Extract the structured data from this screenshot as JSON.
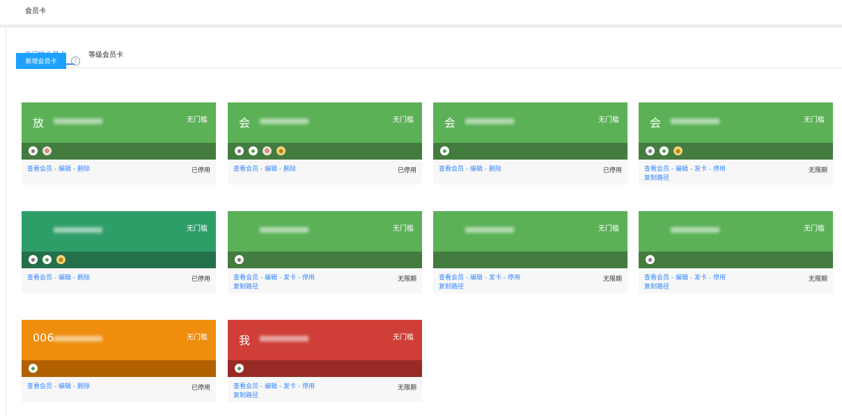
{
  "page_title": "会员卡",
  "tabs": [
    {
      "label": "无门槛会员卡",
      "active": true
    },
    {
      "label": "等级会员卡",
      "active": false
    }
  ],
  "add_button": "新增会员卡",
  "help": "?",
  "colors": {
    "accent": "#3388ff",
    "green": "#5cb157",
    "green_dark": "#437c3e",
    "teal": "#2e9e69",
    "teal_dark": "#24704b",
    "orange": "#ef8d0d",
    "orange_dark": "#b26100",
    "red": "#cf3f37",
    "red_dark": "#982a25"
  },
  "cards": [
    {
      "name": "放",
      "threshold": "无门槛",
      "status": "已停用",
      "actions": [
        "查看会员",
        "编辑",
        "删除"
      ],
      "link2": "",
      "icons": [
        "circle-icon",
        "gift-icon"
      ],
      "theme": "green"
    },
    {
      "name": "会",
      "threshold": "无门槛",
      "status": "已停用",
      "actions": [
        "查看会员",
        "编辑",
        "删除"
      ],
      "link2": "",
      "icons": [
        "circle-icon",
        "leaf-icon",
        "gift-icon",
        "coin-icon"
      ],
      "theme": "green"
    },
    {
      "name": "会",
      "threshold": "无门槛",
      "status": "已停用",
      "actions": [
        "查看会员",
        "编辑",
        "删除"
      ],
      "link2": "",
      "icons": [
        "leaf-icon"
      ],
      "theme": "green"
    },
    {
      "name": "会",
      "threshold": "无门槛",
      "status": "无限期",
      "actions": [
        "查看会员",
        "编辑",
        "发卡",
        "停用"
      ],
      "link2": "复制路径",
      "icons": [
        "circle-icon",
        "leaf-icon",
        "coin-icon"
      ],
      "theme": "green"
    },
    {
      "name": "",
      "threshold": "无门槛",
      "status": "已停用",
      "actions": [
        "查看会员",
        "编辑",
        "删除"
      ],
      "link2": "",
      "icons": [
        "circle-icon",
        "leaf-icon",
        "coin-icon"
      ],
      "theme": "teal"
    },
    {
      "name": "",
      "threshold": "无门槛",
      "status": "无限期",
      "actions": [
        "查看会员",
        "编辑",
        "发卡",
        "停用"
      ],
      "link2": "复制路径",
      "icons": [
        "circle-icon"
      ],
      "theme": "green"
    },
    {
      "name": "",
      "threshold": "无门槛",
      "status": "无限期",
      "actions": [
        "查看会员",
        "编辑",
        "发卡",
        "停用"
      ],
      "link2": "复制路径",
      "icons": [],
      "theme": "green"
    },
    {
      "name": "",
      "threshold": "无门槛",
      "status": "无限期",
      "actions": [
        "查看会员",
        "编辑",
        "发卡",
        "停用"
      ],
      "link2": "复制路径",
      "icons": [
        "circle-icon"
      ],
      "theme": "green"
    },
    {
      "name": "006",
      "threshold": "无门槛",
      "status": "已停用",
      "actions": [
        "查看会员",
        "编辑",
        "删除"
      ],
      "link2": "",
      "icons": [
        "leaf-icon"
      ],
      "theme": "orange"
    },
    {
      "name": "我",
      "threshold": "无门槛",
      "status": "无限期",
      "actions": [
        "查看会员",
        "编辑",
        "发卡",
        "停用"
      ],
      "link2": "复制路径",
      "icons": [
        "leaf-icon"
      ],
      "theme": "red"
    }
  ]
}
